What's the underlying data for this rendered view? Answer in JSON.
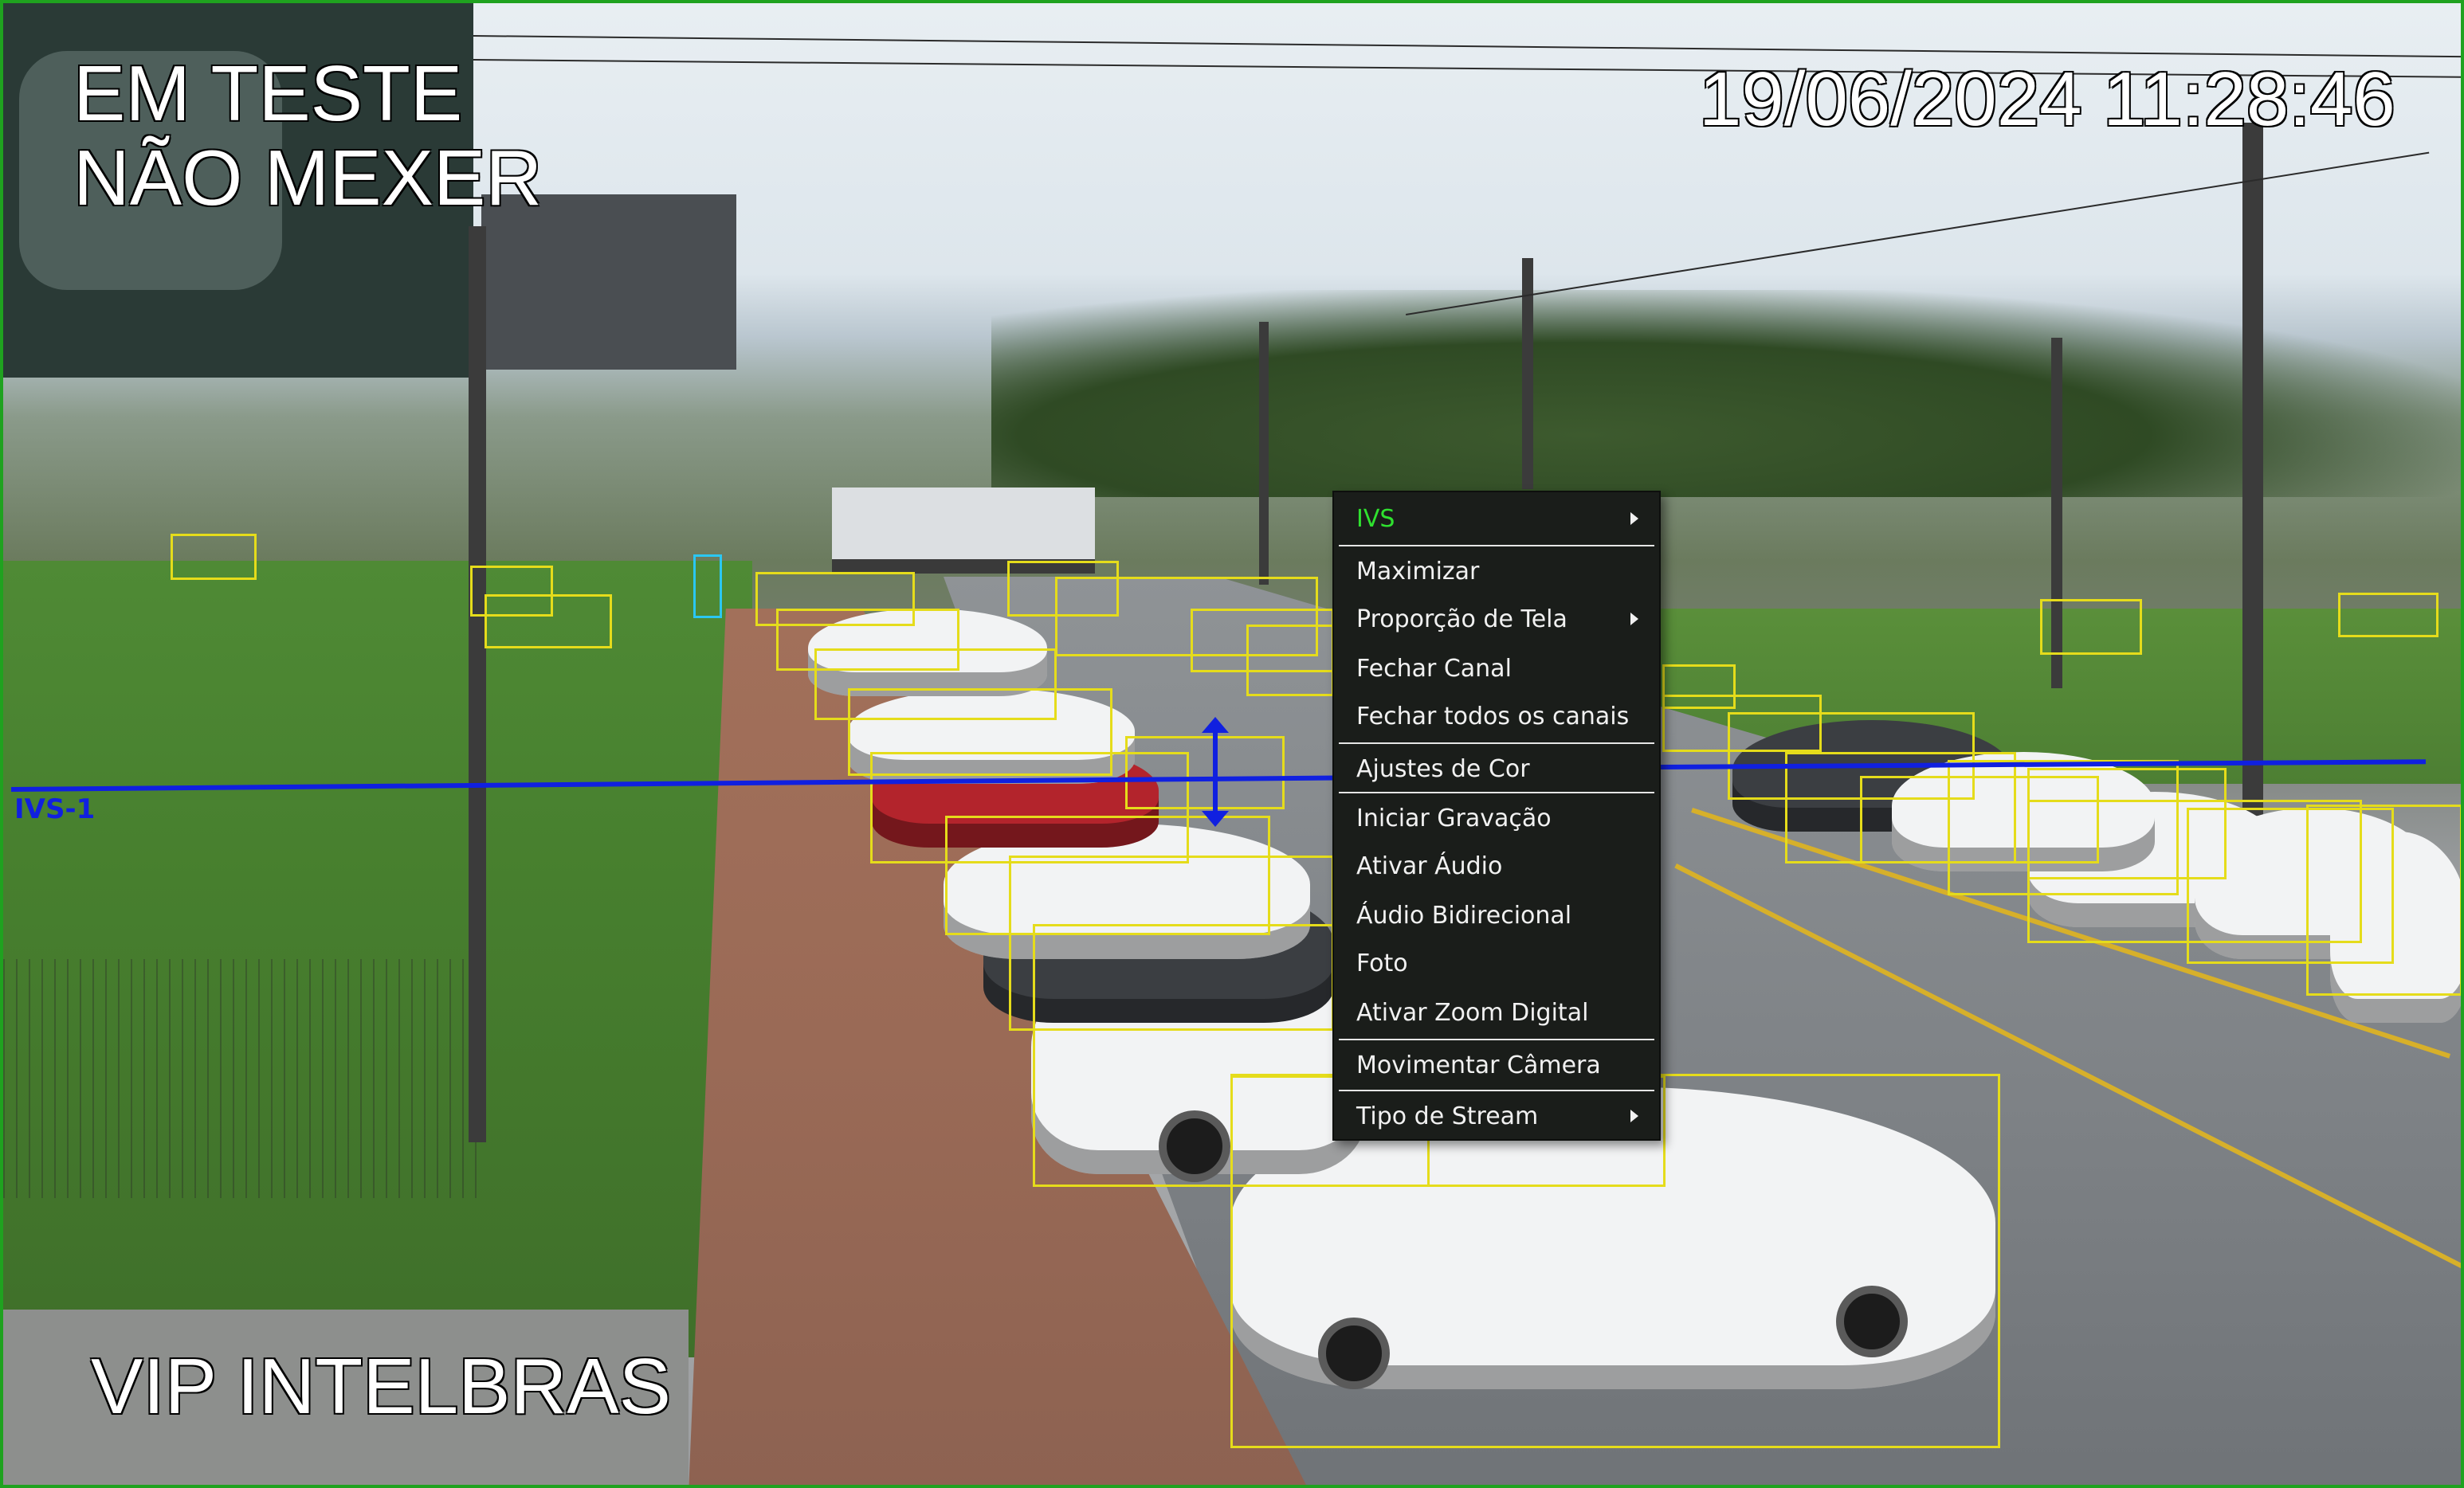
{
  "overlay": {
    "title_lines": "EM TESTE\nNÃO MEXER",
    "timestamp": "19/06/2024 11:28:46",
    "channel_name": "VIP INTELBRAS",
    "ivs_rule_label": "IVS-1"
  },
  "context_menu": {
    "items": [
      {
        "label": "IVS",
        "submenu": true,
        "active": true
      },
      {
        "label": "Maximizar",
        "submenu": false
      },
      {
        "label": "Proporção de Tela",
        "submenu": true
      },
      {
        "label": "Fechar Canal",
        "submenu": false
      },
      {
        "label": "Fechar todos os canais",
        "submenu": false
      },
      {
        "label": "Ajustes de Cor",
        "submenu": false
      },
      {
        "label": "Iniciar Gravação",
        "submenu": false
      },
      {
        "label": "Ativar Áudio",
        "submenu": false
      },
      {
        "label": "Áudio Bidirecional",
        "submenu": false
      },
      {
        "label": "Foto",
        "submenu": false
      },
      {
        "label": "Ativar Zoom Digital",
        "submenu": false
      },
      {
        "label": "Movimentar Câmera",
        "submenu": false
      },
      {
        "label": "Tipo de Stream",
        "submenu": true
      }
    ]
  },
  "colors": {
    "frame_border": "#1fa21f",
    "detection_box": "#e5dc1b",
    "person_box": "#2bc7f2",
    "ivs_line": "#1020e0",
    "menu_active": "#2fe12f"
  }
}
